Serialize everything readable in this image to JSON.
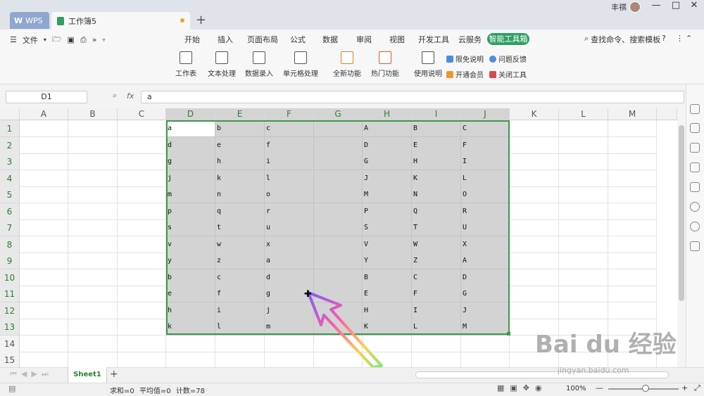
{
  "tabs": {
    "wps_label": "WPS",
    "doc_label": "工作簿5",
    "new_tab": "+"
  },
  "user": {
    "name": "丰祺"
  },
  "window": {
    "minimize": "—",
    "maximize": "□",
    "close": "✕"
  },
  "menu": {
    "file": "文件",
    "items": [
      "开始",
      "插入",
      "页面布局",
      "公式",
      "数据",
      "审阅",
      "视图",
      "开发工具",
      "云服务"
    ],
    "active": "智能工具箱",
    "search": "查找命令、搜索模板",
    "help": "?"
  },
  "ribbon": {
    "buttons": [
      "工作表",
      "文本处理",
      "数据录入",
      "单元格处理",
      "全新功能",
      "热门功能",
      "使用说明"
    ],
    "small": [
      "限免说明",
      "问题反馈",
      "开通会员",
      "关闭工具"
    ]
  },
  "formula": {
    "name_box": "D1",
    "fx": "fx",
    "value": "a"
  },
  "columns": [
    "A",
    "B",
    "C",
    "D",
    "E",
    "F",
    "G",
    "H",
    "I",
    "J",
    "K",
    "L",
    "M"
  ],
  "rows": [
    "1",
    "2",
    "3",
    "4",
    "5",
    "6",
    "7",
    "8",
    "9",
    "10",
    "11",
    "12",
    "13",
    "14",
    "15"
  ],
  "table": {
    "D": [
      "a",
      "d",
      "g",
      "j",
      "m",
      "p",
      "s",
      "v",
      "y",
      "b",
      "e",
      "h",
      "k"
    ],
    "E": [
      "b",
      "e",
      "h",
      "k",
      "n",
      "q",
      "t",
      "w",
      "z",
      "c",
      "f",
      "i",
      "l"
    ],
    "F": [
      "c",
      "f",
      "i",
      "l",
      "o",
      "r",
      "u",
      "x",
      "a",
      "d",
      "g",
      "j",
      "m"
    ],
    "H": [
      "A",
      "D",
      "G",
      "J",
      "M",
      "P",
      "S",
      "V",
      "Y",
      "B",
      "E",
      "H",
      "K"
    ],
    "I": [
      "B",
      "E",
      "H",
      "K",
      "N",
      "Q",
      "T",
      "W",
      "Z",
      "C",
      "F",
      "I",
      "L"
    ],
    "J": [
      "C",
      "F",
      "I",
      "L",
      "O",
      "R",
      "U",
      "X",
      "A",
      "D",
      "G",
      "J",
      "M"
    ]
  },
  "sheet": {
    "name": "Sheet1",
    "add": "+"
  },
  "status": {
    "sum": "求和=0",
    "avg": "平均值=0",
    "count": "计数=78",
    "zoom": "100%"
  },
  "watermark": {
    "main": "Bai du 经验",
    "sub": "jingyan.baidu.com"
  },
  "colors": {
    "accent": "#2f9e63",
    "selection_border": "#3b9a4a",
    "selection_fill": "#d3d3d3"
  }
}
